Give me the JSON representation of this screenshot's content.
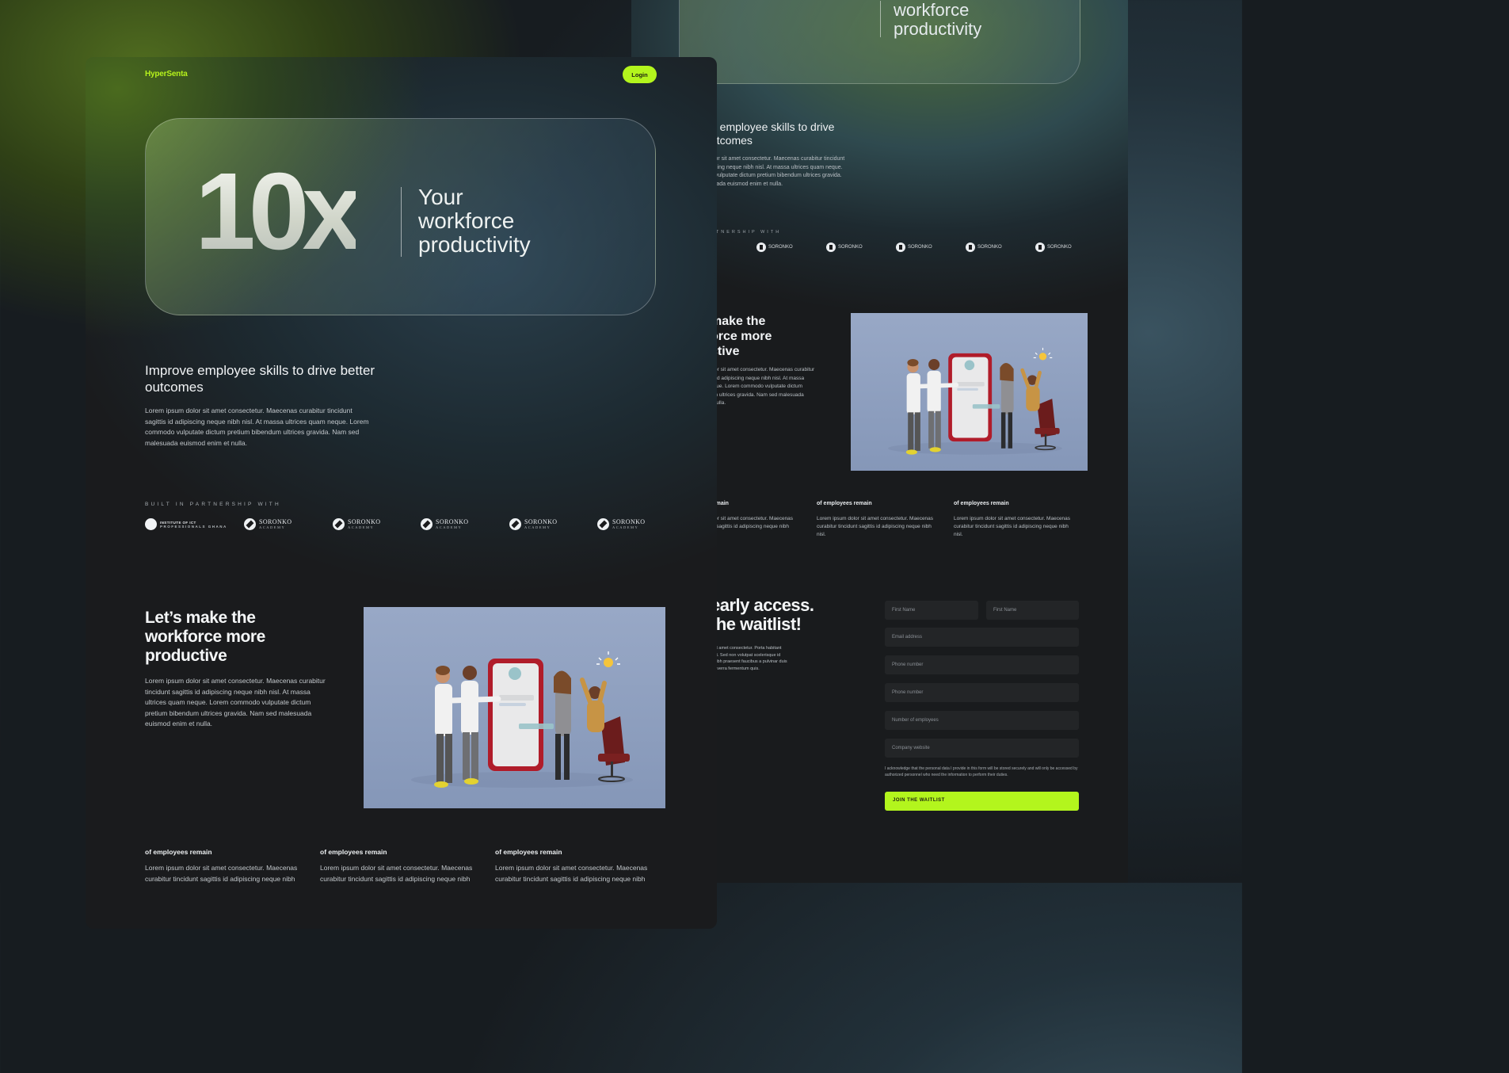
{
  "brand": "HyperSenta",
  "nav": {
    "login_label": "Login"
  },
  "hero": {
    "big": "10x",
    "tagline_lines": [
      "Your",
      "workforce",
      "productivity"
    ]
  },
  "improve": {
    "heading": "Improve employee skills to drive better outcomes",
    "heading_back": "e employee skills to drive\nutcomes",
    "body": "Lorem ipsum dolor sit amet consectetur. Maecenas curabitur tincidunt sagittis id adipiscing neque nibh nisl. At massa ultrices quam neque. Lorem commodo vulputate dictum pretium bibendum ultrices gravida. Nam sed malesuada euismod enim et nulla.",
    "body_back": "olor sit amet consectetur. Maecenas curabitur tincidunt\niscing neque nibh nisl. At massa ultrices quam neque.\no vulputate dictum pretium bibendum ultrices gravida.\nsuada euismod enim et nulla."
  },
  "partners": {
    "label": "BUILT IN PARTNERSHIP WITH",
    "label_back": "RTNERSHIP WITH",
    "first": {
      "name": "INSTITUTE OF ICT",
      "sub": "PROFESSIONALS GHANA"
    },
    "logos": [
      {
        "name": "SORONKO",
        "sub": "ACADEMY"
      },
      {
        "name": "SORONKO",
        "sub": "ACADEMY"
      },
      {
        "name": "SORONKO",
        "sub": "ACADEMY"
      },
      {
        "name": "SORONKO",
        "sub": "ACADEMY"
      },
      {
        "name": "SORONKO",
        "sub": "ACADEMY"
      }
    ]
  },
  "make": {
    "heading": "Let’s make the workforce more productive",
    "heading_back": "make the\norce more\nctive",
    "body": "Lorem ipsum dolor sit amet consectetur. Maecenas curabitur tincidunt sagittis id adipiscing neque nibh nisl. At massa ultrices quam neque. Lorem commodo vulputate dictum pretium bibendum ultrices gravida. Nam sed malesuada euismod enim et nulla.",
    "body_back": "olor sit amet consectetur. Maecenas curabitur\nis id adipiscing neque nibh nisl. At massa\neque. Lorem commodo vulputate dictum\num ultrices gravida. Nam sed malesuada\nt nulla."
  },
  "stats": [
    {
      "title": "of employees remain",
      "body": "Lorem ipsum dolor sit amet consectetur. Maecenas curabitur tincidunt sagittis id adipiscing neque nibh"
    },
    {
      "title": "of employees remain",
      "body": "Lorem ipsum dolor sit amet consectetur. Maecenas curabitur tincidunt sagittis id adipiscing neque nibh"
    },
    {
      "title": "of employees remain",
      "body": "Lorem ipsum dolor sit amet consectetur. Maecenas curabitur tincidunt sagittis id adipiscing neque nibh"
    }
  ],
  "stats_back": [
    {
      "title": "remain",
      "body": "olor sit amet consectetur. Maecenas\nnt sagittis id adipiscing neque nibh"
    },
    {
      "title": "of employees remain",
      "body": "Lorem ipsum dolor sit amet consectetur. Maecenas curabitur tincidunt sagittis id adipiscing neque nibh nisl."
    },
    {
      "title": "of employees remain",
      "body": "Lorem ipsum dolor sit amet consectetur. Maecenas curabitur tincidunt sagittis id adipiscing neque nibh nisl."
    }
  ],
  "waitlist": {
    "heading": "early access.\nthe waitlist!",
    "body": "r sit amet consectetur. Porta habitant\nndit. Sed non volutpat scelerisque id\nc nibh praesent faucibus a pulvinar duis\ns viverra fermentum quis.",
    "fields": {
      "first_name_1": "First Name",
      "first_name_2": "First Name",
      "email": "Email address",
      "phone_1": "Phone number",
      "phone_2": "Phone number",
      "employees": "Number of employees",
      "website": "Company website"
    },
    "consent": "I acknowledge that the personal data I provide in this form will be stored securely and will only be accessed by authorized personnel who need the information to perform their duties.",
    "button": "JOIN THE WAITLIST"
  },
  "colors": {
    "accent": "#b3f51d",
    "bg": "#1a1b1d"
  }
}
